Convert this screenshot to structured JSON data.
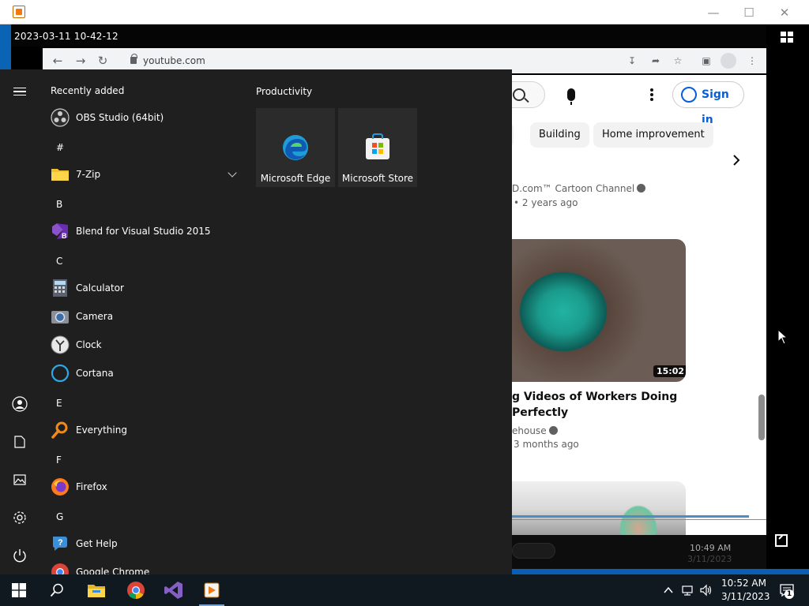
{
  "player": {
    "timestamp": "2023-03-11 10-42-12"
  },
  "browser": {
    "url": "youtube.com"
  },
  "youtube": {
    "sign_in": "Sign in",
    "chips": [
      "Building",
      "Home improvement"
    ],
    "video1": {
      "channel_partial": "D.com™ Cartoon Channel",
      "meta_partial": "• 2 years ago"
    },
    "video2": {
      "duration": "15:02",
      "title_line1": "g Videos of Workers Doing",
      "title_line2": "Perfectly",
      "channel_partial": "ehouse",
      "meta_partial": "3 months ago"
    },
    "inner_clock": {
      "time": "10:49 AM",
      "date": "3/11/2023"
    }
  },
  "start_menu": {
    "recently_added_label": "Recently added",
    "recently_added": [
      {
        "label": "OBS Studio (64bit)"
      }
    ],
    "groups": [
      {
        "letter": "#",
        "apps": [
          {
            "label": "7-Zip"
          }
        ]
      },
      {
        "letter": "B",
        "apps": [
          {
            "label": "Blend for Visual Studio 2015"
          }
        ]
      },
      {
        "letter": "C",
        "apps": [
          {
            "label": "Calculator"
          },
          {
            "label": "Camera"
          },
          {
            "label": "Clock"
          },
          {
            "label": "Cortana"
          }
        ]
      },
      {
        "letter": "E",
        "apps": [
          {
            "label": "Everything"
          }
        ]
      },
      {
        "letter": "F",
        "apps": [
          {
            "label": "Firefox"
          }
        ]
      },
      {
        "letter": "G",
        "apps": [
          {
            "label": "Get Help"
          },
          {
            "label": "Google Chrome"
          }
        ]
      }
    ],
    "tiles_group_label": "Productivity",
    "tiles": [
      {
        "label": "Microsoft Edge"
      },
      {
        "label": "Microsoft Store"
      }
    ]
  },
  "taskbar": {
    "clock_time": "10:52 AM",
    "clock_date": "3/11/2023",
    "notification_count": "1"
  }
}
